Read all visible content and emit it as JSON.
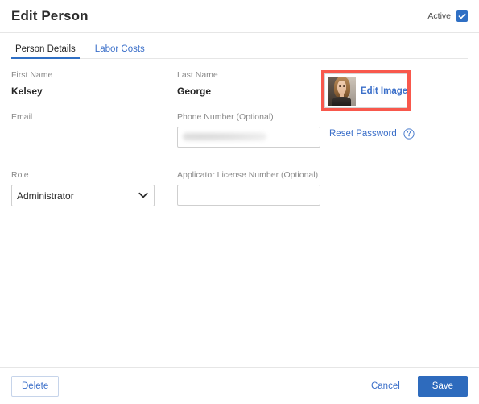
{
  "header": {
    "title": "Edit Person",
    "active_label": "Active",
    "active_checked": true,
    "check_icon": "check-icon"
  },
  "tabs": [
    {
      "label": "Person Details",
      "active": true
    },
    {
      "label": "Labor Costs",
      "active": false
    }
  ],
  "fields": {
    "first_name": {
      "label": "First Name",
      "value": "Kelsey"
    },
    "last_name": {
      "label": "Last Name",
      "value": "George"
    },
    "email": {
      "label": "Email",
      "value": ""
    },
    "phone": {
      "label": "Phone Number (Optional)",
      "value": "",
      "placeholder": "",
      "redacted": true
    },
    "role": {
      "label": "Role",
      "value": "Administrator",
      "options": [
        "Administrator"
      ],
      "chevron_icon": "chevron-down-icon"
    },
    "license": {
      "label": "Applicator License Number (Optional)",
      "value": "",
      "placeholder": ""
    }
  },
  "image_panel": {
    "edit_image_label": "Edit Image",
    "avatar_icon": "user-photo-avatar",
    "highlight_color": "#f8584c"
  },
  "password": {
    "reset_label": "Reset Password",
    "help_icon": "help-circle-icon"
  },
  "footer": {
    "delete_label": "Delete",
    "cancel_label": "Cancel",
    "save_label": "Save"
  },
  "colors": {
    "accent_blue": "#2f6fc4",
    "link_blue": "#3b6fc9",
    "save_blue": "#2e6bbd",
    "highlight_red": "#f8584c",
    "label_gray": "#8a8a8a",
    "border_gray": "#e6e6e6"
  }
}
